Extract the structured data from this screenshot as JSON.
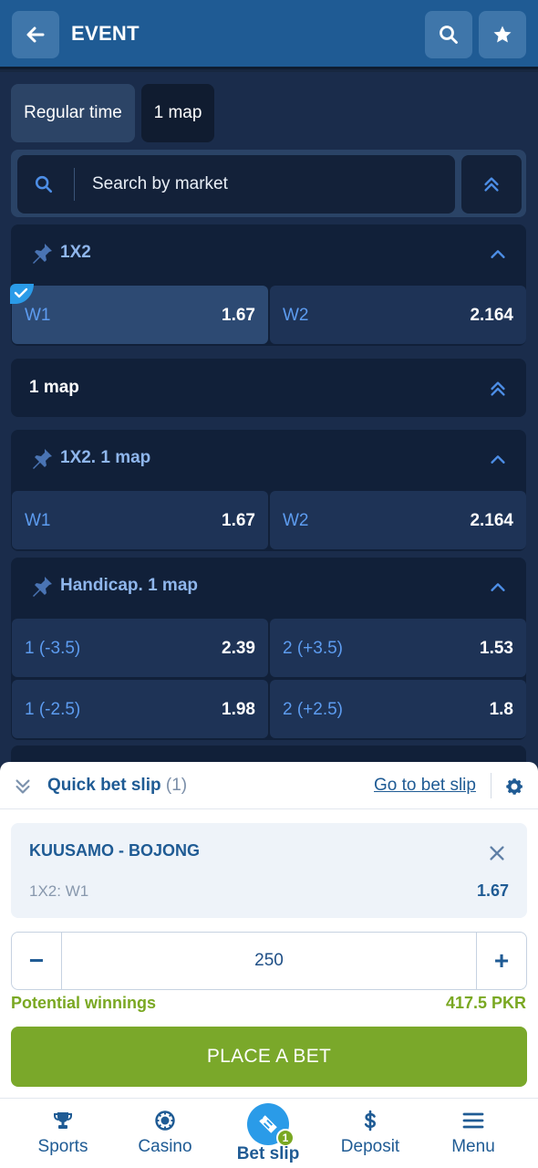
{
  "header": {
    "title": "EVENT"
  },
  "tabs": [
    {
      "label": "Regular time",
      "active": true
    },
    {
      "label": "1 map",
      "active": false
    }
  ],
  "search": {
    "placeholder": "Search by market"
  },
  "markets": [
    {
      "title": "1X2",
      "odds": [
        {
          "label": "W1",
          "value": "1.67",
          "selected": true
        },
        {
          "label": "W2",
          "value": "2.164",
          "selected": false
        }
      ]
    },
    {
      "title": "1X2. 1 map",
      "odds": [
        {
          "label": "W1",
          "value": "1.67"
        },
        {
          "label": "W2",
          "value": "2.164"
        }
      ]
    },
    {
      "title": "Handicap. 1 map",
      "odds": [
        {
          "label": "1 (-3.5)",
          "value": "2.39"
        },
        {
          "label": "2 (+3.5)",
          "value": "1.53"
        },
        {
          "label": "1 (-2.5)",
          "value": "1.98"
        },
        {
          "label": "2 (+2.5)",
          "value": "1.8"
        }
      ]
    }
  ],
  "group": {
    "title": "1 map"
  },
  "betslip": {
    "title": "Quick bet slip",
    "count": "(1)",
    "goto_label": "Go to bet slip",
    "event": "KUUSAMO - BOJONG",
    "market": "1X2: W1",
    "odd": "1.67",
    "stake": "250",
    "minus": "−",
    "plus": "+",
    "potential_label": "Potential winnings",
    "potential_value": "417.5 PKR",
    "place_label": "PLACE A BET"
  },
  "nav": [
    {
      "label": "Sports",
      "icon": "trophy-icon"
    },
    {
      "label": "Casino",
      "icon": "casino-chip-icon"
    },
    {
      "label": "Bet slip",
      "icon": "ticket-icon",
      "badge": "1",
      "active": true
    },
    {
      "label": "Deposit",
      "icon": "dollar-icon"
    },
    {
      "label": "Menu",
      "icon": "hamburger-icon"
    }
  ],
  "colors": {
    "header": "#1f5b94",
    "background": "#1a2c4b",
    "odd_label": "#5d9cf0",
    "accent_green": "#7aa822",
    "active_nav": "#2a9be8"
  }
}
